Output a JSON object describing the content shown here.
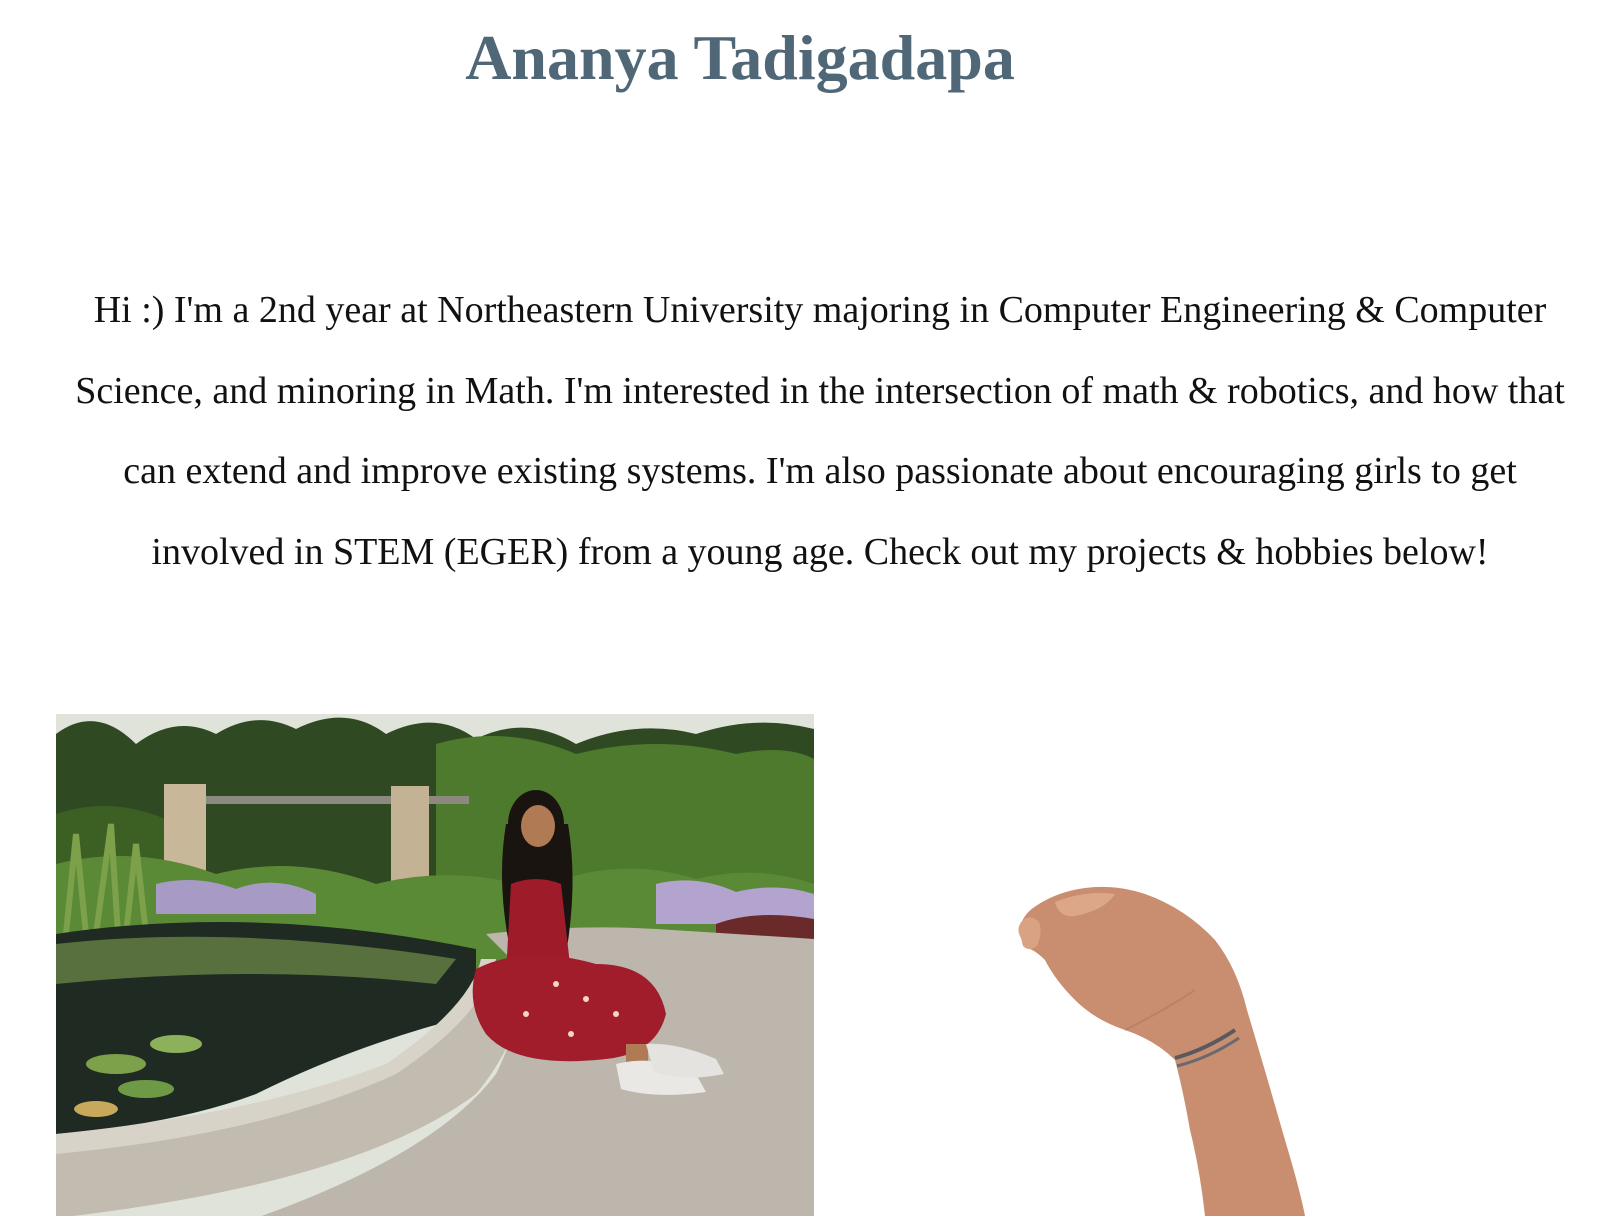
{
  "header": {
    "name": "Ananya Tadigadapa"
  },
  "intro": {
    "text": "Hi :) I'm a 2nd year at Northeastern University majoring in Computer Engineering & Computer Science, and minoring in Math. I'm interested in the intersection of math & robotics, and how that can extend and improve existing systems. I'm also passionate about encouraging girls to get involved in STEM (EGER) from a young age. Check out my projects & hobbies below!"
  },
  "images": {
    "portrait": "portrait-photo-garden-pond",
    "hand": "waving-hand-cutout"
  },
  "colors": {
    "title": "#4f6777",
    "body_text": "#111111",
    "background": "#ffffff"
  }
}
